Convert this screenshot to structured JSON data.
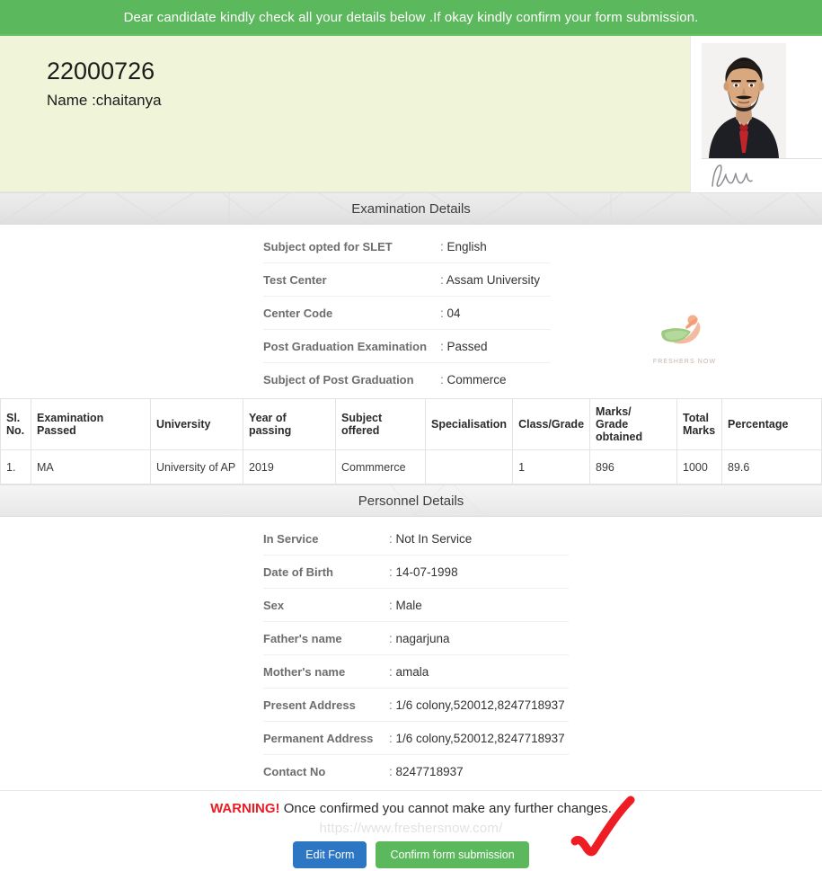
{
  "banner": {
    "message": "Dear candidate kindly check all your details below .If okay kindly confirm your form submission."
  },
  "profile": {
    "application_no": "22000726",
    "name_line": "Name :chaitanya",
    "photo_alt": "candidate-photo",
    "signature_alt": "candidate-signature"
  },
  "watermark": {
    "logo_caption": "FRESHERS NOW",
    "url": "https://www.freshersnow.com/"
  },
  "exam_section": {
    "title": "Examination Details",
    "rows": [
      {
        "label": "Subject opted for SLET",
        "value": "English"
      },
      {
        "label": "Test Center",
        "value": "Assam University"
      },
      {
        "label": "Center Code",
        "value": "04"
      },
      {
        "label": "Post Graduation Examination",
        "value": "Passed"
      },
      {
        "label": "Subject of Post Graduation",
        "value": "Commerce"
      }
    ]
  },
  "education_table": {
    "headers": [
      "Sl. No.",
      "Examination Passed",
      "University",
      "Year of passing",
      "Subject offered",
      "Specialisation",
      "Class/Grade",
      "Marks/ Grade obtained",
      "Total Marks",
      "Percentage"
    ],
    "columns": [
      "Sl. No.",
      "Examination Passed",
      "University",
      "Year of passing",
      "Subject offered",
      "Specialisation",
      "Class/Grade",
      "Marks/Grade obtained",
      "Total Marks",
      "Percentage"
    ],
    "header_cells": {
      "sl_no_line1": "Sl.",
      "sl_no_line2": "No.",
      "exam_passed": "Examination Passed",
      "university": "University",
      "year_of_passing": "Year of passing",
      "subject_offered": "Subject offered",
      "specialisation": "Specialisation",
      "class_grade": "Class/Grade",
      "marks_line1": "Marks/",
      "marks_line2": "Grade obtained",
      "total_line1": "Total",
      "total_line2": "Marks",
      "percentage": "Percentage"
    },
    "rows": [
      {
        "sl_no": "1.",
        "exam_passed": "MA",
        "university": "University of AP",
        "year_of_passing": "2019",
        "subject_offered": "Commmerce",
        "specialisation": "",
        "class_grade": "1",
        "marks_obtained": "896",
        "total_marks": "1000",
        "percentage": "89.6"
      }
    ]
  },
  "personnel_section": {
    "title": "Personnel Details",
    "rows": [
      {
        "label": "In Service",
        "value": "Not In Service"
      },
      {
        "label": "Date of Birth",
        "value": "14-07-1998"
      },
      {
        "label": "Sex",
        "value": "Male"
      },
      {
        "label": "Father's name",
        "value": "nagarjuna"
      },
      {
        "label": "Mother's name",
        "value": "amala"
      },
      {
        "label": "Present Address",
        "value": "1/6 colony,520012,8247718937"
      },
      {
        "label": "Permanent Address",
        "value": "1/6 colony,520012,8247718937"
      },
      {
        "label": "Contact No",
        "value": "8247718937"
      }
    ]
  },
  "footer": {
    "warning_word": "WARNING!",
    "warning_text": "Once confirmed you cannot make any further changes.",
    "edit_button": "Edit Form",
    "confirm_button": "Confirm form submission"
  },
  "colors": {
    "banner_green": "#5cb85c",
    "profile_bg": "#f0f4d8",
    "warning_red": "#ec1c24",
    "edit_blue": "#2d76c4",
    "confirm_green": "#5cb85c",
    "annotation_red": "#ee1c23"
  }
}
